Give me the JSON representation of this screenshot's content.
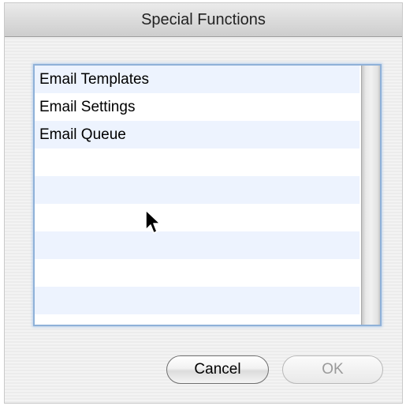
{
  "window": {
    "title": "Special Functions"
  },
  "list": {
    "items": [
      {
        "label": "Email Templates"
      },
      {
        "label": "Email Settings"
      },
      {
        "label": "Email Queue"
      },
      {
        "label": ""
      },
      {
        "label": ""
      },
      {
        "label": ""
      },
      {
        "label": ""
      },
      {
        "label": ""
      },
      {
        "label": ""
      },
      {
        "label": ""
      }
    ]
  },
  "buttons": {
    "cancel_label": "Cancel",
    "ok_label": "OK",
    "ok_enabled": false
  },
  "colors": {
    "row_stripe": "#edf3fe",
    "focus_ring": "#8fb1d8",
    "disabled_text": "#9a9a9a"
  }
}
